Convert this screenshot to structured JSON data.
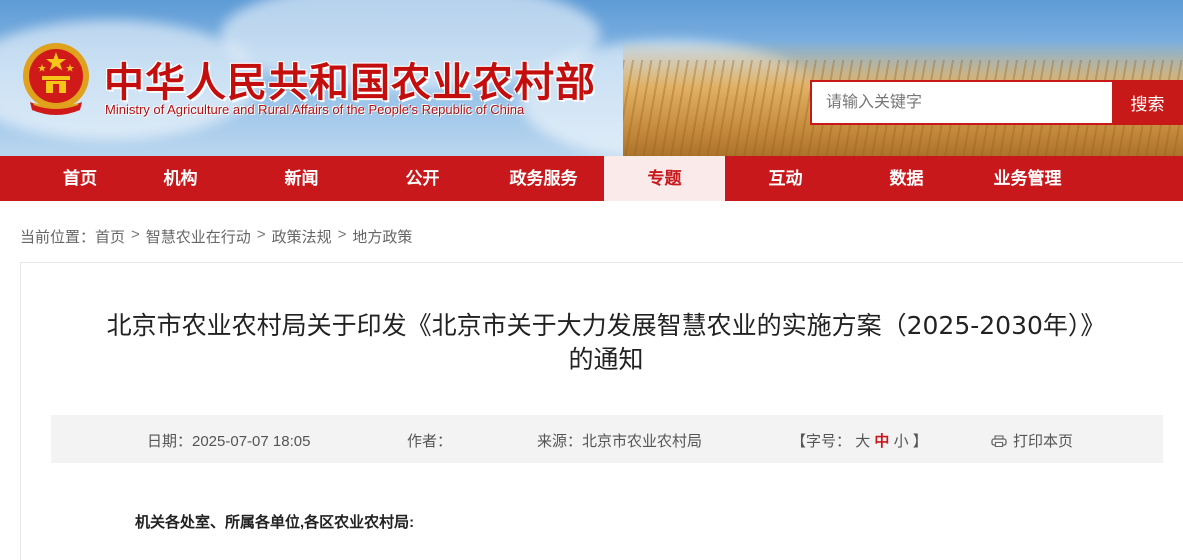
{
  "header": {
    "title_cn": "中华人民共和国农业农村部",
    "title_en": "Ministry of Agriculture and Rural Affairs of the People's Republic of China",
    "search": {
      "placeholder": "请输入关键字",
      "button_label": "搜索"
    }
  },
  "nav": {
    "items": [
      {
        "label": "首页"
      },
      {
        "label": "机构"
      },
      {
        "label": "新闻"
      },
      {
        "label": "公开"
      },
      {
        "label": "政务服务"
      },
      {
        "label": "专题"
      },
      {
        "label": "互动"
      },
      {
        "label": "数据"
      },
      {
        "label": "业务管理"
      }
    ],
    "active_index": 5
  },
  "breadcrumb": {
    "prefix": "当前位置：",
    "items": [
      "首页",
      "智慧农业在行动",
      "政策法规",
      "地方政策"
    ],
    "separator": ">"
  },
  "article": {
    "title_line1": "北京市农业农村局关于印发《北京市关于大力发展智慧农业的实施方案（2025-2030年）》",
    "title_line2": "的通知",
    "meta": {
      "date": "日期：2025-07-07 18:05",
      "author": "作者：",
      "source": "来源：北京市农业农村局",
      "font_size_open": "【字号：",
      "font_size_large": "大",
      "font_size_medium": "中",
      "font_size_small": "小",
      "font_size_close": "】",
      "print_label": "打印本页"
    },
    "salutation": "机关各处室、所属各单位,各区农业农村局:"
  },
  "colors": {
    "brand_red": "#c8181c",
    "active_tab_bg": "#fbeaea",
    "meta_bar_bg": "#f3f3f3"
  },
  "icons": {
    "emblem": "national-emblem-icon",
    "print": "printer-icon"
  }
}
